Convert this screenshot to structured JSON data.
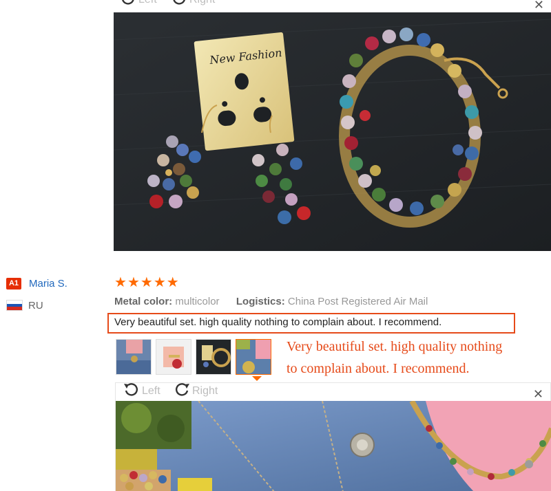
{
  "viewer_top": {
    "rotate_left_label": "Left",
    "rotate_right_label": "Right",
    "close_icon": "close-icon",
    "photo_card_text": "New Fashion"
  },
  "review": {
    "user": {
      "level_badge": "A1",
      "name": "Maria S.",
      "country_code": "RU"
    },
    "rating_stars": 5,
    "meta": {
      "metal_color_label": "Metal color:",
      "metal_color_value": "multicolor",
      "logistics_label": "Logistics:",
      "logistics_value": "China Post Registered Air Mail"
    },
    "text": "Very beautiful set. high quality nothing to complain about. I recommend.",
    "thumbnails_count": 4,
    "active_thumbnail": 4
  },
  "annotation": {
    "line1": "Very beautiful set. high quality nothing",
    "line2": "to complain about. I recommend."
  },
  "viewer_bottom": {
    "rotate_left_label": "Left",
    "rotate_right_label": "Right",
    "close_icon": "close-icon"
  },
  "colors": {
    "accent_orange": "#ff6a00",
    "highlight_red": "#e64a19",
    "link_blue": "#2068bd",
    "badge_red": "#e62e04"
  }
}
